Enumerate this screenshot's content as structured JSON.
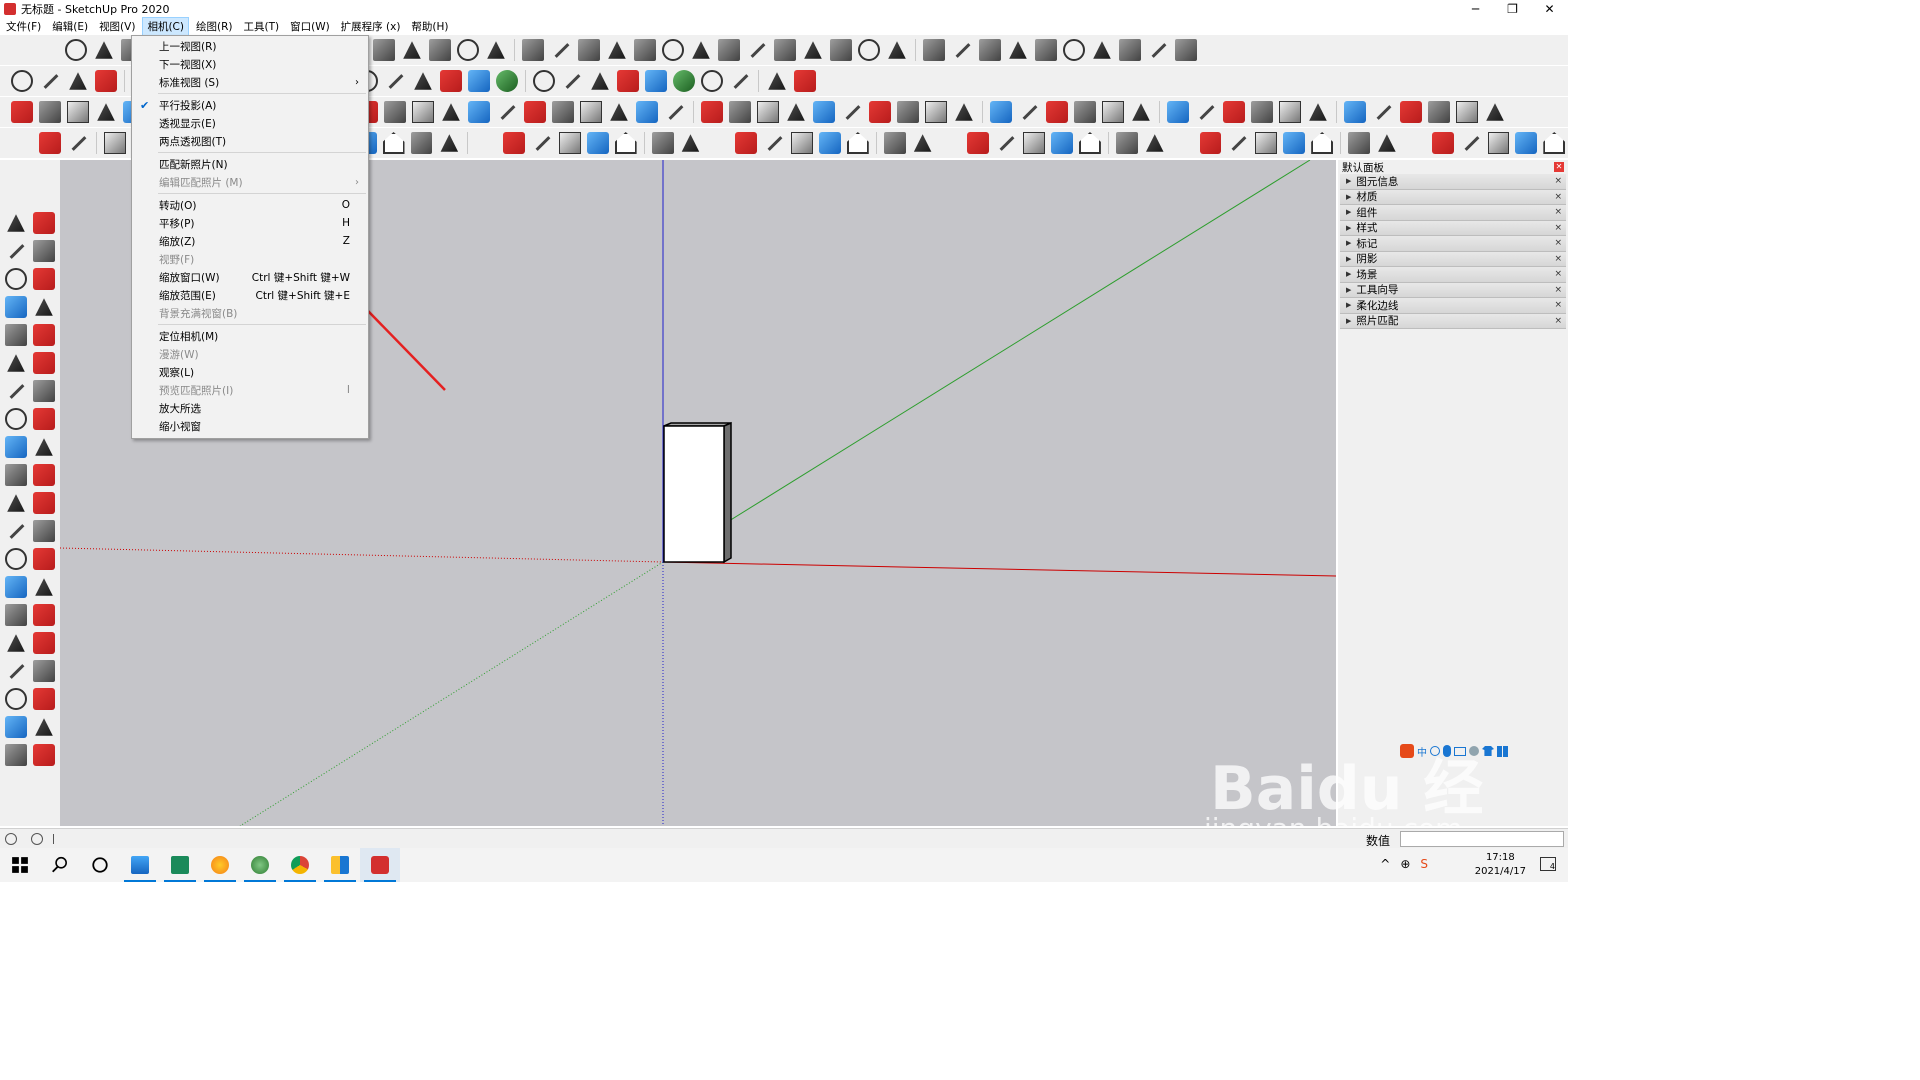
{
  "window": {
    "title": "无标题 - SketchUp Pro 2020",
    "minimize": "─",
    "restore": "❐",
    "close": "✕"
  },
  "menubar": {
    "items": [
      {
        "label": "文件(F)"
      },
      {
        "label": "编辑(E)"
      },
      {
        "label": "视图(V)"
      },
      {
        "label": "相机(C)"
      },
      {
        "label": "绘图(R)"
      },
      {
        "label": "工具(T)"
      },
      {
        "label": "窗口(W)"
      },
      {
        "label": "扩展程序 (x)"
      },
      {
        "label": "帮助(H)"
      }
    ]
  },
  "camera_menu": {
    "items": [
      {
        "label": "上一视图(R)",
        "shortcut": "",
        "disabled": false
      },
      {
        "label": "下一视图(X)",
        "shortcut": "",
        "disabled": false
      },
      {
        "label": "标准视图 (S)",
        "shortcut": "›",
        "disabled": false
      },
      {
        "label": "平行投影(A)",
        "shortcut": "",
        "disabled": false,
        "checked": true
      },
      {
        "label": "透视显示(E)",
        "shortcut": "",
        "disabled": false
      },
      {
        "label": "两点透视图(T)",
        "shortcut": "",
        "disabled": false
      },
      {
        "label": "匹配新照片(N)",
        "shortcut": "",
        "disabled": false
      },
      {
        "label": "编辑匹配照片 (M)",
        "shortcut": "›",
        "disabled": true
      },
      {
        "label": "转动(O)",
        "shortcut": "O",
        "disabled": false
      },
      {
        "label": "平移(P)",
        "shortcut": "H",
        "disabled": false
      },
      {
        "label": "缩放(Z)",
        "shortcut": "Z",
        "disabled": false
      },
      {
        "label": "视野(F)",
        "shortcut": "",
        "disabled": true
      },
      {
        "label": "缩放窗口(W)",
        "shortcut": "Ctrl 键+Shift 键+W",
        "disabled": false
      },
      {
        "label": "缩放范围(E)",
        "shortcut": "Ctrl 键+Shift 键+E",
        "disabled": false
      },
      {
        "label": "背景充满视窗(B)",
        "shortcut": "",
        "disabled": true
      },
      {
        "label": "定位相机(M)",
        "shortcut": "",
        "disabled": false
      },
      {
        "label": "漫游(W)",
        "shortcut": "",
        "disabled": true
      },
      {
        "label": "观察(L)",
        "shortcut": "",
        "disabled": false
      },
      {
        "label": "预览匹配照片(I)",
        "shortcut": "I",
        "disabled": true
      },
      {
        "label": "放大所选",
        "shortcut": "",
        "disabled": false
      },
      {
        "label": "缩小视窗",
        "shortcut": "",
        "disabled": false
      }
    ],
    "check_mark": "✔"
  },
  "tray": {
    "title": "默认面板",
    "close": "✕",
    "items": [
      {
        "label": "图元信息"
      },
      {
        "label": "材质"
      },
      {
        "label": "组件"
      },
      {
        "label": "样式"
      },
      {
        "label": "标记"
      },
      {
        "label": "阴影"
      },
      {
        "label": "场景"
      },
      {
        "label": "工具向导"
      },
      {
        "label": "柔化边线"
      },
      {
        "label": "照片匹配"
      }
    ],
    "item_close": "×"
  },
  "statusbar": {
    "measure_label": "数值"
  },
  "taskbar": {
    "time": "17:18",
    "date": "2021/4/17",
    "notification_count": "4"
  },
  "ime": {
    "label": "中"
  },
  "watermark": {
    "big": "Baidu 经验",
    "small": "jingyan.baidu.com"
  },
  "colors": {
    "viewport_bg": "#c5c5c9",
    "axis_red": "#cc0000",
    "axis_green": "#2e9e2e",
    "axis_blue": "#2020cc",
    "annotation_arrow": "#e52020",
    "menu_highlight": "#cde8ff"
  }
}
